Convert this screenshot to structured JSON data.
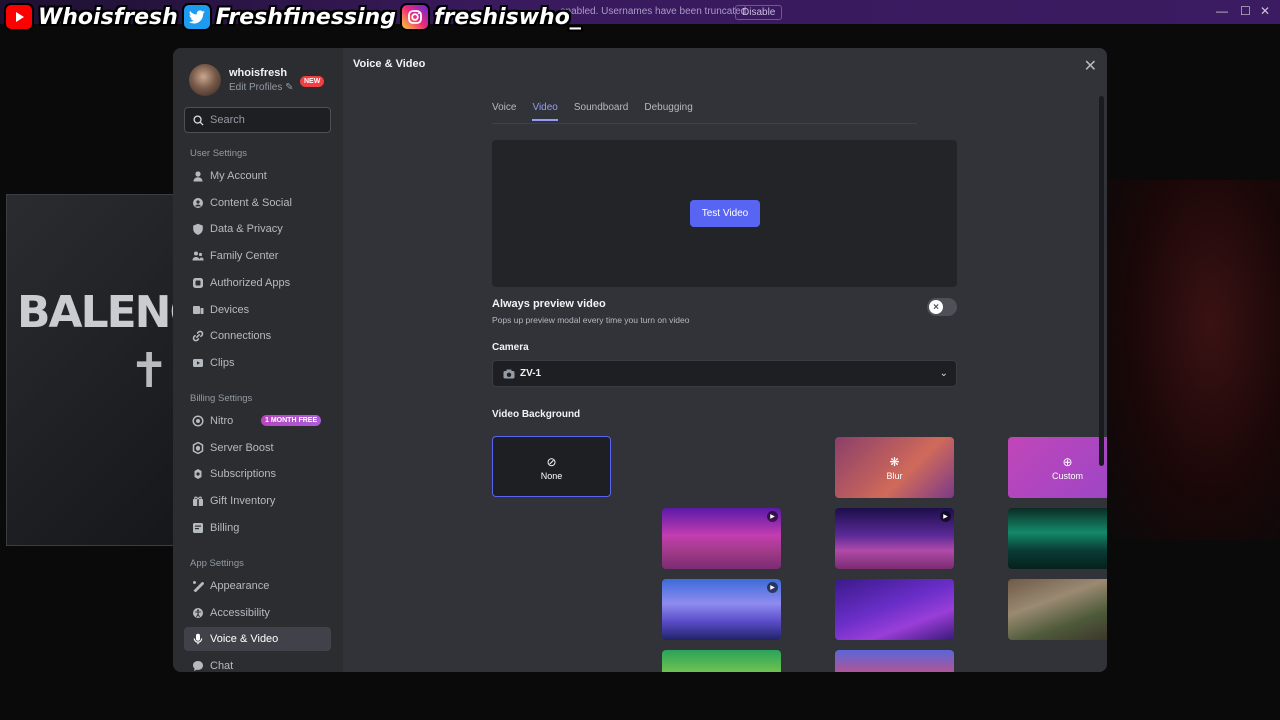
{
  "topbar": {
    "notice": "enabled. Usernames have been truncated.",
    "disable_label": "Disable",
    "minimize": "—",
    "maximize": "☐",
    "close": "✕"
  },
  "overlay": {
    "youtube": "Whoisfresh",
    "twitter": "Freshfinessing",
    "instagram": "freshiswho_"
  },
  "webcam": {
    "logo_text": "BALENC",
    "cross": "✝"
  },
  "sidebar": {
    "username": "whoisfresh",
    "edit_profiles": "Edit Profiles ✎",
    "new_badge": "NEW",
    "search_placeholder": "Search",
    "user_settings_header": "User Settings",
    "user_settings": [
      {
        "label": "My Account",
        "icon": "person-icon"
      },
      {
        "label": "Content & Social",
        "icon": "content-icon"
      },
      {
        "label": "Data & Privacy",
        "icon": "shield-icon"
      },
      {
        "label": "Family Center",
        "icon": "family-icon"
      },
      {
        "label": "Authorized Apps",
        "icon": "apps-icon"
      },
      {
        "label": "Devices",
        "icon": "devices-icon"
      },
      {
        "label": "Connections",
        "icon": "link-icon"
      },
      {
        "label": "Clips",
        "icon": "clips-icon"
      }
    ],
    "billing_settings_header": "Billing Settings",
    "billing_settings": [
      {
        "label": "Nitro",
        "icon": "nitro-icon"
      },
      {
        "label": "Server Boost",
        "icon": "boost-icon"
      },
      {
        "label": "Subscriptions",
        "icon": "subscriptions-icon"
      },
      {
        "label": "Gift Inventory",
        "icon": "gift-icon"
      },
      {
        "label": "Billing",
        "icon": "billing-icon"
      }
    ],
    "nitro_badge": "1 MONTH FREE",
    "app_settings_header": "App Settings",
    "app_settings": [
      {
        "label": "Appearance",
        "icon": "appearance-icon"
      },
      {
        "label": "Accessibility",
        "icon": "accessibility-icon"
      },
      {
        "label": "Voice & Video",
        "icon": "mic-icon"
      },
      {
        "label": "Chat",
        "icon": "chat-icon"
      }
    ],
    "active_item": "Voice & Video"
  },
  "content": {
    "title": "Voice & Video",
    "close": "✕",
    "tabs": [
      "Voice",
      "Video",
      "Soundboard",
      "Debugging"
    ],
    "active_tab": "Video",
    "test_video": "Test Video",
    "always_preview_title": "Always preview video",
    "always_preview_sub": "Pops up preview modal every time you turn on video",
    "always_preview_on": false,
    "camera_label": "Camera",
    "camera_value": "ZV-1",
    "video_bg_label": "Video Background",
    "backgrounds": [
      {
        "label": "None",
        "icon": "⊘"
      },
      {
        "label": "Blur",
        "icon": "❋"
      },
      {
        "label": "Custom",
        "icon": "⊕"
      }
    ]
  },
  "colors": {
    "accent": "#5865f2",
    "tab_active": "#949cf7",
    "nitro_badge": "#b845c1",
    "new_badge": "#f23f43"
  }
}
